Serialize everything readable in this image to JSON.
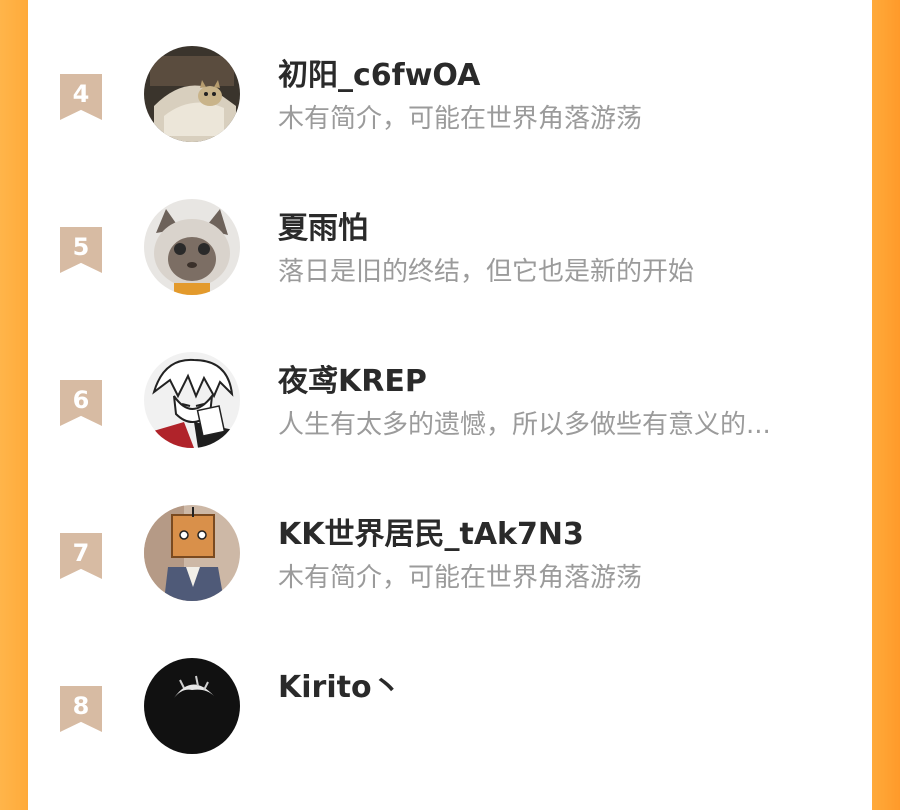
{
  "ranking_list": {
    "items": [
      {
        "rank": "4",
        "name": "初阳_c6fwOA",
        "bio": "木有简介，可能在世界角落游荡",
        "avatar": "cat-in-box-avatar"
      },
      {
        "rank": "5",
        "name": "夏雨怕",
        "bio": "落日是旧的终结，但它也是新的开始",
        "avatar": "siamese-cat-avatar"
      },
      {
        "rank": "6",
        "name": "夜鸢KREP",
        "bio": "人生有太多的遗憾，所以多做些有意义的...",
        "avatar": "anime-character-avatar"
      },
      {
        "rank": "7",
        "name": "KK世界居民_tAk7N3",
        "bio": "木有简介，可能在世界角落游荡",
        "avatar": "box-head-character-avatar"
      },
      {
        "rank": "8",
        "name": "Kirito丶",
        "bio": "",
        "avatar": "dark-anime-avatar"
      }
    ]
  },
  "colors": {
    "side_accent": "#ffaa3a",
    "rank_badge": "#d7bba3",
    "name_text": "#2a2a2a",
    "bio_text": "#9b9b9b"
  }
}
